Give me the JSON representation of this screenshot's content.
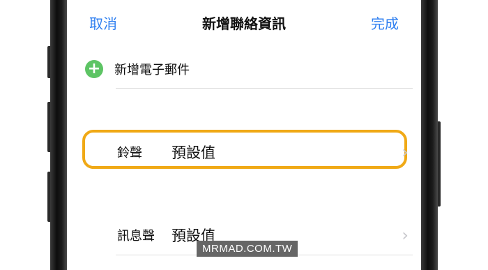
{
  "nav": {
    "cancel": "取消",
    "title": "新增聯絡資訊",
    "done": "完成"
  },
  "add_email": {
    "icon": "plus-circle-icon",
    "label": "新增電子郵件",
    "accent": "#5dc464"
  },
  "settings": [
    {
      "label": "鈴聲",
      "value": "預設值"
    },
    {
      "label": "訊息聲",
      "value": "預設值"
    }
  ],
  "highlight_color": "#f0a916",
  "watermark": "MRMAD.COM.TW"
}
